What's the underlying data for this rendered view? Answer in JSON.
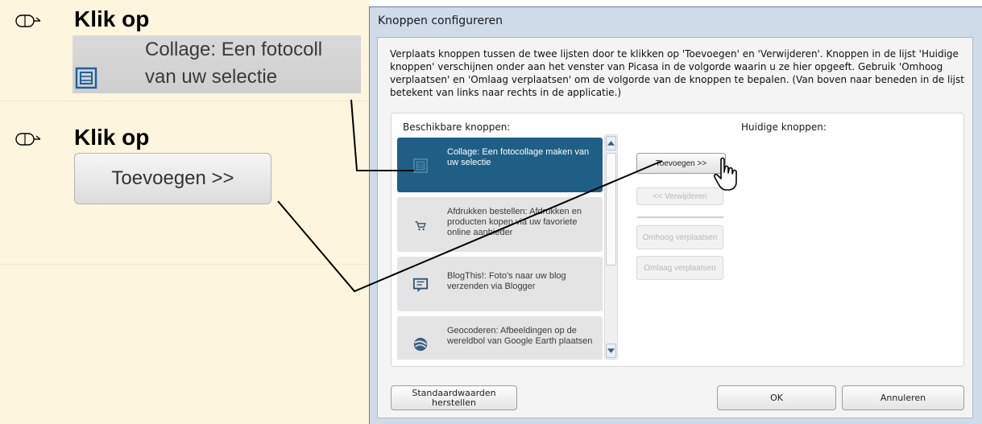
{
  "tutorial": {
    "steps": [
      {
        "title": "Klik op"
      },
      {
        "title": "Klik op"
      }
    ],
    "zoom_collage": {
      "line1": "Collage:  Een fotocoll",
      "line2": "van uw selectie",
      "icon": "collage-icon"
    },
    "zoom_button": {
      "label": "Toevoegen >>"
    }
  },
  "dialog": {
    "title": "Knoppen configureren",
    "description": "Verplaats knoppen tussen de twee lijsten door te klikken op 'Toevoegen' en 'Verwijderen'. Knoppen in de lijst 'Huidige knoppen' verschijnen onder aan het venster van Picasa in de volgorde waarin u ze hier opgeeft. Gebruik 'Omhoog verplaatsen' en 'Omlaag verplaatsen' om de volgorde van de knoppen te bepalen. (Van boven naar beneden in de lijst betekent van links naar rechts in de applicatie.)",
    "available_label": "Beschikbare knoppen:",
    "current_label": "Huidige knoppen:",
    "available_items": [
      {
        "text": "Collage:  Een fotocollage maken van uw selectie",
        "icon": "collage-icon",
        "selected": true
      },
      {
        "text": "Afdrukken bestellen:  Afdrukken en producten kopen via uw favoriete online aanbieder",
        "icon": "cart-icon",
        "selected": false
      },
      {
        "text": "BlogThis!:  Foto's naar uw blog verzenden via Blogger",
        "icon": "blog-icon",
        "selected": false
      },
      {
        "text": "Geocoderen:  Afbeeldingen op de wereldbol van Google Earth plaatsen",
        "icon": "globe-icon",
        "selected": false
      }
    ],
    "buttons": {
      "add": "Toevoegen >>",
      "remove": "<< Verwijderen",
      "move_up": "Omhoog verplaatsen",
      "move_down": "Omlaag verplaatsen"
    },
    "footer": {
      "defaults": "Standaardwaarden herstellen",
      "ok": "OK",
      "cancel": "Annuleren"
    },
    "colors": {
      "selected_item": "#1f5f86",
      "frame": "#cfdbe9",
      "tutorial_bg": "#fef5df"
    }
  }
}
